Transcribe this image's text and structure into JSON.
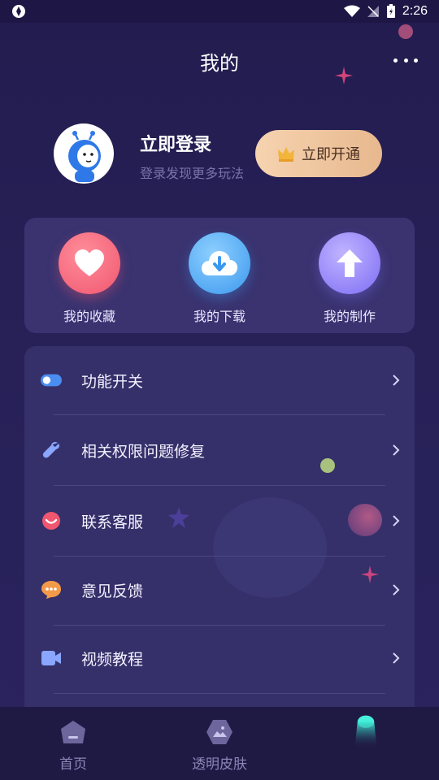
{
  "status_bar": {
    "time": "2:26"
  },
  "header": {
    "title": "我的"
  },
  "profile": {
    "login_title": "立即登录",
    "login_subtitle": "登录发现更多玩法",
    "vip_button_label": "立即开通"
  },
  "quick_actions": [
    {
      "label": "我的收藏",
      "icon": "heart-icon"
    },
    {
      "label": "我的下载",
      "icon": "cloud-download-icon"
    },
    {
      "label": "我的制作",
      "icon": "upload-arrow-icon"
    }
  ],
  "menu": [
    {
      "label": "功能开关",
      "icon": "toggle-icon"
    },
    {
      "label": "相关权限问题修复",
      "icon": "wrench-icon"
    },
    {
      "label": "联系客服",
      "icon": "customer-service-icon"
    },
    {
      "label": "意见反馈",
      "icon": "feedback-icon"
    },
    {
      "label": "视频教程",
      "icon": "video-icon"
    }
  ],
  "bottom_nav": [
    {
      "label": "首页",
      "icon": "home-icon"
    },
    {
      "label": "透明皮肤",
      "icon": "skin-icon"
    },
    {
      "label": "",
      "icon": "mine-glow-icon"
    }
  ],
  "colors": {
    "background": "#241e52",
    "card": "#3a3370",
    "vip_gold": "#e7b88e",
    "accent_pink": "#f0566f",
    "accent_blue": "#3b98ee",
    "accent_purple": "#7d6cf4"
  }
}
